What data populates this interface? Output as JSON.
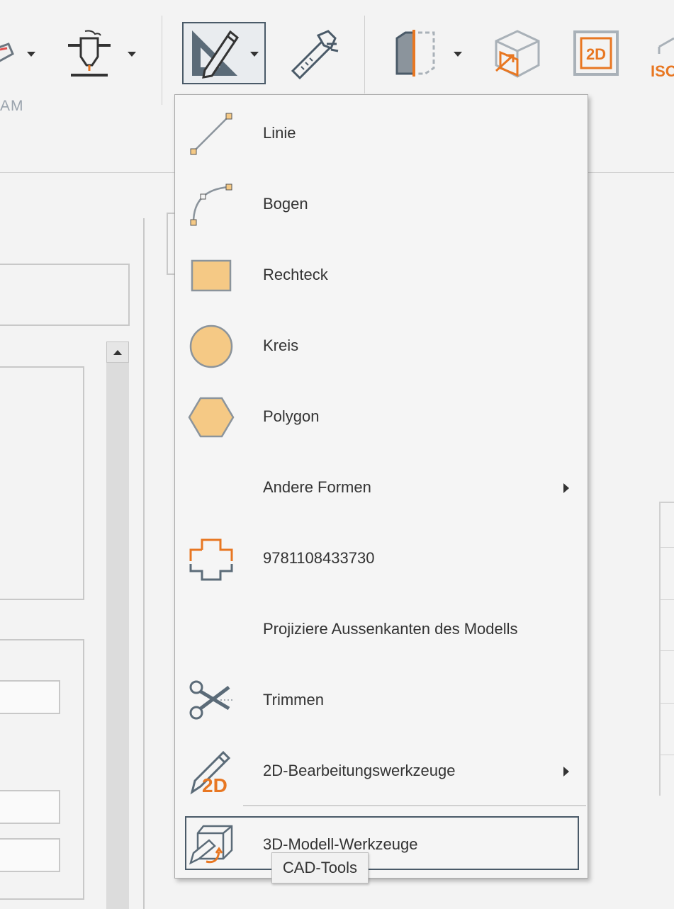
{
  "ribbon": {
    "group_label_cam": "AM",
    "tools": [
      {
        "icon": "cam-shape-icon",
        "has_dropdown": true
      },
      {
        "icon": "plasma-torch-icon",
        "has_dropdown": true
      },
      {
        "icon": "sketch-ruler-pencil-icon",
        "has_dropdown": true,
        "active": true
      },
      {
        "icon": "caliper-icon",
        "has_dropdown": false
      },
      {
        "icon": "section-view-icon",
        "has_dropdown": true
      },
      {
        "icon": "cube-export-icon",
        "has_dropdown": false
      },
      {
        "icon": "2d-view-icon",
        "label": "2D",
        "has_dropdown": false
      },
      {
        "icon": "iso-view-icon",
        "label": "ISO",
        "has_dropdown": false
      }
    ]
  },
  "menu": {
    "items": [
      {
        "label": "Linie",
        "icon": "line-icon",
        "submenu": false
      },
      {
        "label": "Bogen",
        "icon": "arc-icon",
        "submenu": false
      },
      {
        "label": "Rechteck",
        "icon": "rectangle-icon",
        "submenu": false
      },
      {
        "label": "Kreis",
        "icon": "circle-icon",
        "submenu": false
      },
      {
        "label": "Polygon",
        "icon": "polygon-icon",
        "submenu": false
      },
      {
        "label": "Andere Formen",
        "icon": "",
        "submenu": true
      },
      {
        "label": "9781108433730",
        "icon": "cross-profile-icon",
        "submenu": false
      },
      {
        "label": "Projiziere Aussenkanten des Modells",
        "icon": "",
        "submenu": false
      },
      {
        "label": "Trimmen",
        "icon": "scissors-icon",
        "submenu": false
      },
      {
        "label": "2D-Bearbeitungswerkzeuge",
        "icon": "pencil-2d-icon",
        "submenu": true
      },
      {
        "label": "3D-Modell-Werkzeuge",
        "icon": "3d-model-tools-icon",
        "submenu": false,
        "highlighted": true
      }
    ]
  },
  "tooltip": {
    "text": "CAD-Tools"
  },
  "colors": {
    "accent_orange": "#e87722",
    "icon_gray": "#5b6b78",
    "shape_fill": "#f5c985",
    "shape_stroke": "#8b949c"
  }
}
